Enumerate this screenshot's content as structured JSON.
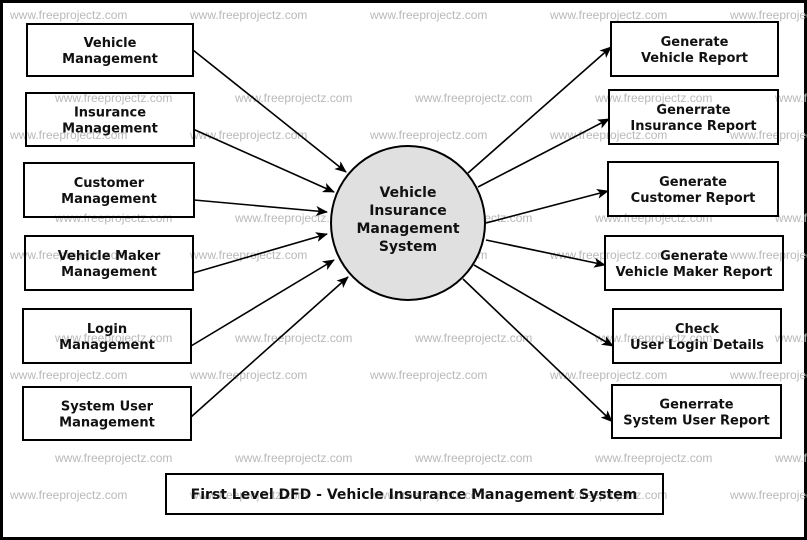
{
  "diagram": {
    "title": "First Level DFD - Vehicle Insurance Management System",
    "central_process": {
      "lines": [
        "Vehicle",
        "Insurance",
        "Management",
        "System"
      ],
      "fill": "#e0e0e0"
    },
    "inputs": [
      {
        "lines": [
          "Vehicle",
          "Management"
        ]
      },
      {
        "lines": [
          "Insurance",
          "Management"
        ]
      },
      {
        "lines": [
          "Customer",
          "Management"
        ]
      },
      {
        "lines": [
          "Vehicle Maker",
          "Management"
        ]
      },
      {
        "lines": [
          "Login",
          "Management"
        ]
      },
      {
        "lines": [
          "System User",
          "Management"
        ]
      }
    ],
    "outputs": [
      {
        "lines": [
          "Generate",
          "Vehicle Report"
        ]
      },
      {
        "lines": [
          "Generrate",
          "Insurance Report"
        ]
      },
      {
        "lines": [
          "Generate",
          "Customer Report"
        ]
      },
      {
        "lines": [
          "Generate",
          "Vehicle Maker Report"
        ]
      },
      {
        "lines": [
          "Check",
          "User Login Details"
        ]
      },
      {
        "lines": [
          "Generrate",
          "System User Report"
        ]
      }
    ],
    "watermark": "www.freeprojectz.com"
  }
}
